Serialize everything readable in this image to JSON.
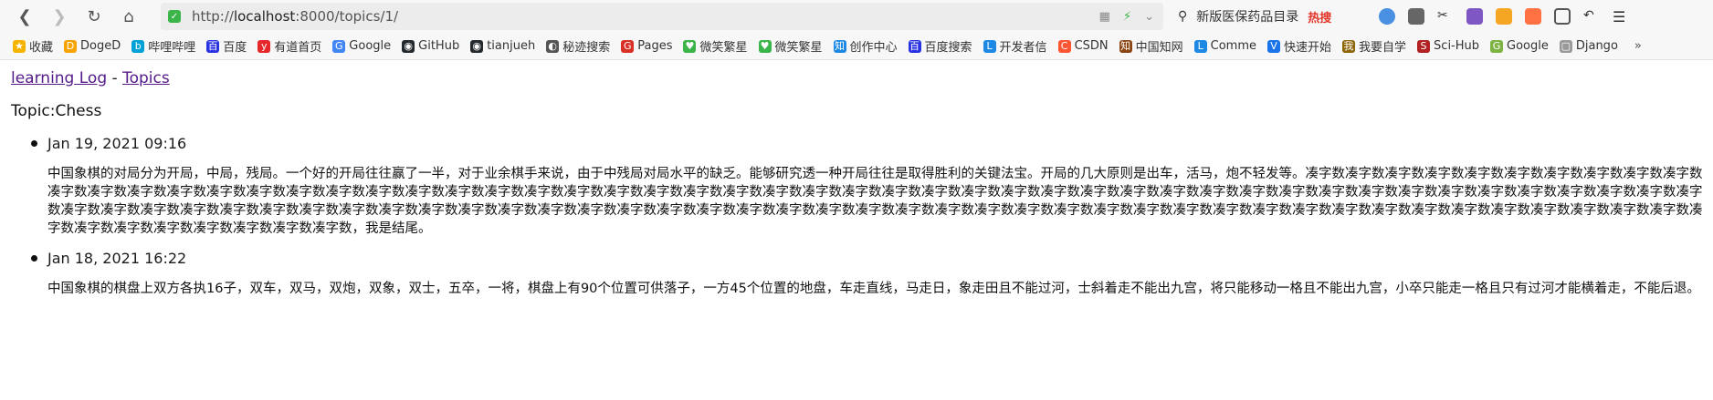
{
  "browser": {
    "url_prefix": "http://",
    "url_host": "localhost",
    "url_rest": ":8000/topics/1/",
    "search_text": "新版医保药品目录",
    "hot_label": "热搜"
  },
  "bookmarks": [
    {
      "label": "收藏",
      "color": "#f5b400",
      "icon": "★"
    },
    {
      "label": "DogeD",
      "color": "#f7a400",
      "icon": "D"
    },
    {
      "label": "哔哩哔哩",
      "color": "#00a1d6",
      "icon": "b"
    },
    {
      "label": "百度",
      "color": "#2932e1",
      "icon": "百"
    },
    {
      "label": "有道首页",
      "color": "#e5262b",
      "icon": "y"
    },
    {
      "label": "Google",
      "color": "#4285f4",
      "icon": "G"
    },
    {
      "label": "GitHub",
      "color": "#24292e",
      "icon": "◉"
    },
    {
      "label": "tianjueh",
      "color": "#24292e",
      "icon": "◉"
    },
    {
      "label": "秘迹搜索",
      "color": "#555555",
      "icon": "◐"
    },
    {
      "label": "Pages",
      "color": "#d93025",
      "icon": "G"
    },
    {
      "label": "微笑繁星",
      "color": "#3bb54a",
      "icon": "♥"
    },
    {
      "label": "微笑繁星",
      "color": "#3bb54a",
      "icon": "♥"
    },
    {
      "label": "创作中心",
      "color": "#1e88e5",
      "icon": "知"
    },
    {
      "label": "百度搜索",
      "color": "#2932e1",
      "icon": "百"
    },
    {
      "label": "开发者信",
      "color": "#1e88e5",
      "icon": "L"
    },
    {
      "label": "CSDN",
      "color": "#fc5531",
      "icon": "C"
    },
    {
      "label": "中国知网",
      "color": "#8b4513",
      "icon": "知"
    },
    {
      "label": "Comme",
      "color": "#1e88e5",
      "icon": "L"
    },
    {
      "label": "快速开始",
      "color": "#1a73e8",
      "icon": "V"
    },
    {
      "label": "我要自学",
      "color": "#8b6508",
      "icon": "我"
    },
    {
      "label": "Sci-Hub",
      "color": "#b22222",
      "icon": "S"
    },
    {
      "label": "Google",
      "color": "#7cb342",
      "icon": "G"
    },
    {
      "label": "Django",
      "color": "#999999",
      "icon": "▢"
    }
  ],
  "bookmarks_more": "»",
  "page": {
    "site_link": "learning Log",
    "separator": " - ",
    "topics_link": "Topics",
    "topic_title": "Topic:Chess"
  },
  "entries": [
    {
      "date": "Jan 19, 2021 09:16",
      "text": "中国象棋的对局分为开局，中局，残局。一个好的开局往往赢了一半，对于业余棋手来说，由于中残局对局水平的缺乏。能够研究透一种开局往往是取得胜利的关键法宝。开局的几大原则是出车，活马，炮不轻发等。凑字数凑字数凑字数凑字数凑字数凑字数凑字数凑字数凑字数凑字数凑字数凑字数凑字数凑字数凑字数凑字数凑字数凑字数凑字数凑字数凑字数凑字数凑字数凑字数凑字数凑字数凑字数凑字数凑字数凑字数凑字数凑字数凑字数凑字数凑字数凑字数凑字数凑字数凑字数凑字数凑字数凑字数凑字数凑字数凑字数凑字数凑字数凑字数凑字数凑字数凑字数凑字数凑字数凑字数凑字数凑字数凑字数凑字数凑字数凑字数凑字数凑字数凑字数凑字数凑字数凑字数凑字数凑字数凑字数凑字数凑字数凑字数凑字数凑字数凑字数凑字数凑字数凑字数凑字数凑字数凑字数凑字数凑字数凑字数凑字数凑字数凑字数凑字数凑字数凑字数凑字数凑字数凑字数凑字数凑字数凑字数凑字数凑字数凑字数凑字数凑字数，我是结尾。"
    },
    {
      "date": "Jan 18, 2021 16:22",
      "text": "中国象棋的棋盘上双方各执16子，双车，双马，双炮，双象，双士，五卒，一将，棋盘上有90个位置可供落子，一方45个位置的地盘，车走直线，马走日，象走田且不能过河，士斜着走不能出九宫，将只能移动一格且不能出九宫，小卒只能走一格且只有过河才能横着走，不能后退。"
    }
  ]
}
